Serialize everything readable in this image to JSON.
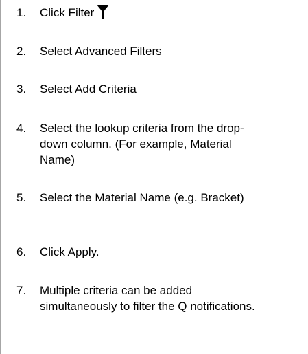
{
  "steps": [
    {
      "number": "1.",
      "text": "Click Filter",
      "icon": "filter-icon"
    },
    {
      "number": "2.",
      "text": "Select Advanced Filters"
    },
    {
      "number": "3.",
      "text": "Select Add Criteria"
    },
    {
      "number": "4.",
      "text": "Select the lookup criteria from the drop-down column. (For example, Material Name)"
    },
    {
      "number": "5.",
      "text": "Select the Material Name (e.g. Bracket)"
    },
    {
      "number": "6.",
      "text": "Click Apply."
    },
    {
      "number": "7.",
      "text": "Multiple criteria can be added simultaneously to filter the Q notifications."
    }
  ],
  "colors": {
    "text": "#000000",
    "rule": "#a6a6a6",
    "background": "#ffffff"
  }
}
